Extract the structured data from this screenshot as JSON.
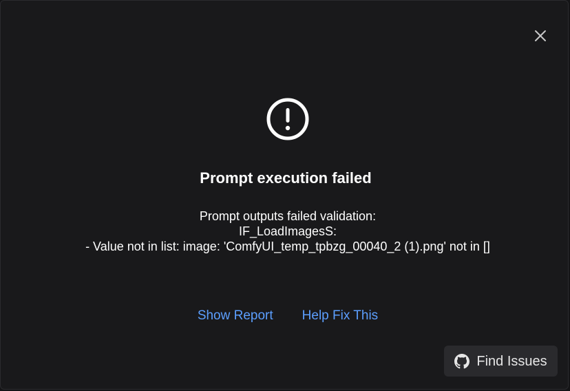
{
  "dialog": {
    "title": "Prompt execution failed",
    "message_lines": [
      "Prompt outputs failed validation:",
      "IF_LoadImagesS:",
      "- Value not in list: image: 'ComfyUI_temp_tpbzg_00040_2 (1).png' not in []"
    ],
    "links": {
      "show_report": "Show Report",
      "help_fix": "Help Fix This"
    },
    "find_issues_label": "Find Issues",
    "icons": {
      "close": "close-icon",
      "alert": "exclamation-circle-icon",
      "github": "github-icon"
    },
    "colors": {
      "background": "#19191b",
      "link": "#5c9fff",
      "button_bg": "#2a2a2d",
      "text": "#ffffff"
    }
  }
}
